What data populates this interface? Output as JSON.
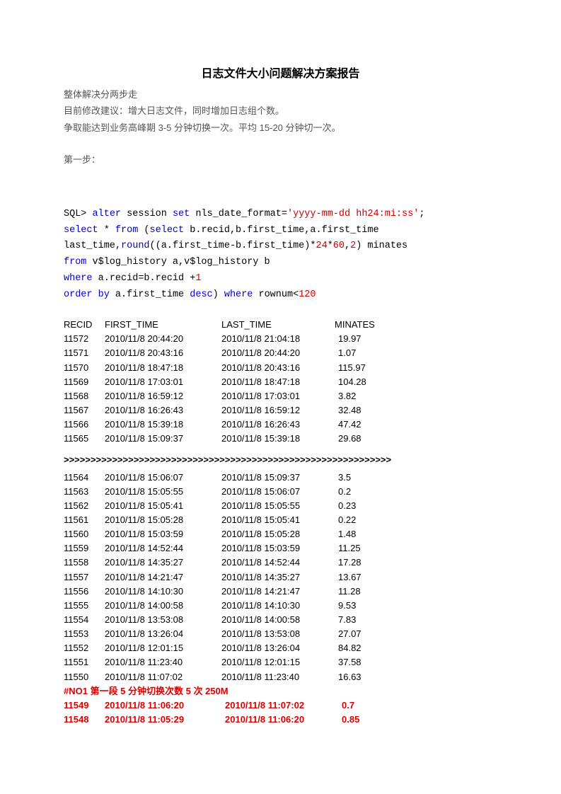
{
  "title": "日志文件大小问题解决方案报告",
  "intro": {
    "l1": "整体解决分两步走",
    "l2": "目前修改建议：增大日志文件，同时增加日志组个数。",
    "l3a": "争取能达到业务高峰期 ",
    "l3b": "3-5",
    "l3c": " 分钟切换一次。平均 ",
    "l3d": "15-20",
    "l3e": " 分钟切一次。",
    "step1": "第一步："
  },
  "sql": {
    "prompt": "SQL> ",
    "l1a": "alter",
    "l1b": " session ",
    "l1c": "set",
    "l1d": " nls_date_format=",
    "l1e": "'yyyy-mm-dd hh24:mi:ss'",
    "l1f": ";",
    "l2a": "select",
    "l2b": " * ",
    "l2c": "from",
    "l2d": " (",
    "l2e": "select",
    "l2f": " b.recid,b.first_time,a.first_time",
    "l3a": "last_time,",
    "l3b": "round",
    "l3c": "((a.first_time-b.first_time)*",
    "l3d": "24",
    "l3e": "*",
    "l3f": "60",
    "l3g": ",",
    "l3h": "2",
    "l3i": ") minates",
    "l4a": "from",
    "l4b": " v$log_history a,v$log_history b",
    "l5a": "where",
    "l5b": " a.recid=b.recid +",
    "l5c": "1",
    "l6a": "order",
    "l6b": " ",
    "l6c": "by",
    "l6d": " a.first_time ",
    "l6e": "desc",
    "l6f": ") ",
    "l6g": "where",
    "l6h": " rownum<",
    "l6i": "120"
  },
  "headers": {
    "c0": "RECID",
    "c1": "FIRST_TIME",
    "c2": "LAST_TIME",
    "c3": "MINATES"
  },
  "rows1": [
    {
      "c0": "11572",
      "c1": "2010/11/8 20:44:20",
      "c2": "2010/11/8 21:04:18",
      "c3": "19.97"
    },
    {
      "c0": "11571",
      "c1": "2010/11/8 20:43:16",
      "c2": "2010/11/8 20:44:20",
      "c3": "1.07"
    },
    {
      "c0": "11570",
      "c1": "2010/11/8 18:47:18",
      "c2": "2010/11/8 20:43:16",
      "c3": "115.97"
    },
    {
      "c0": "11569",
      "c1": "2010/11/8 17:03:01",
      "c2": "2010/11/8 18:47:18",
      "c3": "104.28"
    },
    {
      "c0": "11568",
      "c1": "2010/11/8 16:59:12",
      "c2": "2010/11/8 17:03:01",
      "c3": "3.82"
    },
    {
      "c0": "11567",
      "c1": "2010/11/8 16:26:43",
      "c2": "2010/11/8 16:59:12",
      "c3": "32.48"
    },
    {
      "c0": "11566",
      "c1": "2010/11/8 15:39:18",
      "c2": "2010/11/8 16:26:43",
      "c3": "47.42"
    },
    {
      "c0": "11565",
      "c1": "2010/11/8 15:09:37",
      "c2": "2010/11/8 15:39:18",
      "c3": "29.68"
    }
  ],
  "separator": ">>>>>>>>>>>>>>>>>>>>>>>>>>>>>>>>>>>>>>>>>>>>>>>>>>>>>>>>>>>>>",
  "rows2": [
    {
      "c0": "11564",
      "c1": "2010/11/8 15:06:07",
      "c2": "2010/11/8 15:09:37",
      "c3": "3.5"
    },
    {
      "c0": "11563",
      "c1": "2010/11/8 15:05:55",
      "c2": "2010/11/8 15:06:07",
      "c3": "0.2"
    },
    {
      "c0": "11562",
      "c1": "2010/11/8 15:05:41",
      "c2": "2010/11/8 15:05:55",
      "c3": "0.23"
    },
    {
      "c0": "11561",
      "c1": "2010/11/8 15:05:28",
      "c2": "2010/11/8 15:05:41",
      "c3": "0.22"
    },
    {
      "c0": "11560",
      "c1": "2010/11/8 15:03:59",
      "c2": "2010/11/8 15:05:28",
      "c3": "1.48"
    },
    {
      "c0": "11559",
      "c1": "2010/11/8 14:52:44",
      "c2": "2010/11/8 15:03:59",
      "c3": "11.25"
    },
    {
      "c0": "11558",
      "c1": "2010/11/8 14:35:27",
      "c2": "2010/11/8 14:52:44",
      "c3": "17.28"
    },
    {
      "c0": "11557",
      "c1": "2010/11/8 14:21:47",
      "c2": "2010/11/8 14:35:27",
      "c3": "13.67"
    },
    {
      "c0": "11556",
      "c1": "2010/11/8 14:10:30",
      "c2": "2010/11/8 14:21:47",
      "c3": "11.28"
    },
    {
      "c0": "11555",
      "c1": "2010/11/8 14:00:58",
      "c2": "2010/11/8 14:10:30",
      "c3": "9.53"
    },
    {
      "c0": "11554",
      "c1": "2010/11/8 13:53:08",
      "c2": "2010/11/8 14:00:58",
      "c3": "7.83"
    },
    {
      "c0": "11553",
      "c1": "2010/11/8 13:26:04",
      "c2": "2010/11/8 13:53:08",
      "c3": "27.07"
    },
    {
      "c0": "11552",
      "c1": "2010/11/8 12:01:15",
      "c2": "2010/11/8 13:26:04",
      "c3": "84.82"
    },
    {
      "c0": "11551",
      "c1": "2010/11/8 11:23:40",
      "c2": "2010/11/8 12:01:15",
      "c3": "37.58"
    },
    {
      "c0": "11550",
      "c1": "2010/11/8 11:07:02",
      "c2": "2010/11/8 11:23:40",
      "c3": "16.63"
    }
  ],
  "note": "#NO1  第一段  5 分钟切换次数  5 次  250M",
  "rows3": [
    {
      "c0": "11549",
      "c1": "2010/11/8 11:06:20",
      "c2": "2010/11/8 11:07:02",
      "c3": "0.7"
    },
    {
      "c0": "11548",
      "c1": "2010/11/8 11:05:29",
      "c2": "2010/11/8 11:06:20",
      "c3": "0.85"
    }
  ]
}
